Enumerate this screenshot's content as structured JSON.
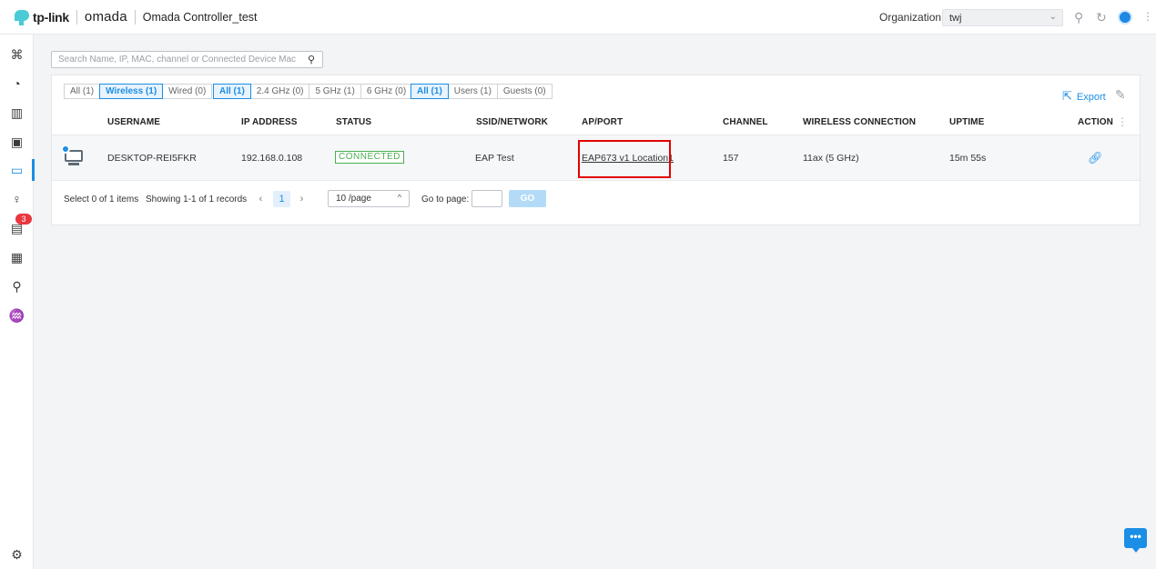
{
  "header": {
    "brand": "tp-link",
    "product": "omada",
    "controller_name": "Omada Controller_test",
    "organization_label": "Organization:",
    "organization_value": "twj"
  },
  "sidebar": {
    "items": [
      {
        "name": "dashboard-icon",
        "glyph": "⌘"
      },
      {
        "name": "statistics-icon",
        "glyph": "◔"
      },
      {
        "name": "map-icon",
        "glyph": "▥"
      },
      {
        "name": "devices-icon",
        "glyph": "▣"
      },
      {
        "name": "clients-icon",
        "glyph": "▭"
      },
      {
        "name": "insight-icon",
        "glyph": "♀"
      },
      {
        "name": "alerts-icon",
        "glyph": "▤"
      },
      {
        "name": "logs-icon",
        "glyph": "▦"
      },
      {
        "name": "tools-icon",
        "glyph": "⚲"
      },
      {
        "name": "reports-icon",
        "glyph": "♒"
      }
    ],
    "alerts_badge": "3",
    "settings_glyph": "⚙"
  },
  "search": {
    "placeholder": "Search Name, IP, MAC, channel or Connected Device Mac"
  },
  "filters": {
    "type": [
      "All (1)",
      "Wireless (1)",
      "Wired (0)"
    ],
    "band": [
      "All (1)",
      "2.4 GHz (0)",
      "5 GHz (1)",
      "6 GHz (0)"
    ],
    "role": [
      "All (1)",
      "Users (1)",
      "Guests (0)"
    ]
  },
  "toolbar": {
    "export_label": "Export"
  },
  "table": {
    "columns": [
      "USERNAME",
      "IP ADDRESS",
      "STATUS",
      "SSID/NETWORK",
      "AP/PORT",
      "CHANNEL",
      "WIRELESS CONNECTION",
      "UPTIME",
      "ACTION"
    ],
    "rows": [
      {
        "username": "DESKTOP-REI5FKR",
        "ip": "192.168.0.108",
        "status": "CONNECTED",
        "ssid": "EAP Test",
        "ap_port": "EAP673 v1 Location1",
        "channel": "157",
        "wireless_connection": "11ax (5 GHz)",
        "uptime": "15m 55s"
      }
    ]
  },
  "pagination": {
    "selected_text": "Select 0 of 1 items",
    "showing_text": "Showing 1-1 of 1 records",
    "current_page": "1",
    "page_size": "10 /page",
    "goto_label": "Go to page:",
    "go_label": "GO"
  },
  "colors": {
    "accent": "#1b8ee5",
    "connected": "#4caf50",
    "highlight": "#e30000",
    "badge": "#e8373f"
  }
}
